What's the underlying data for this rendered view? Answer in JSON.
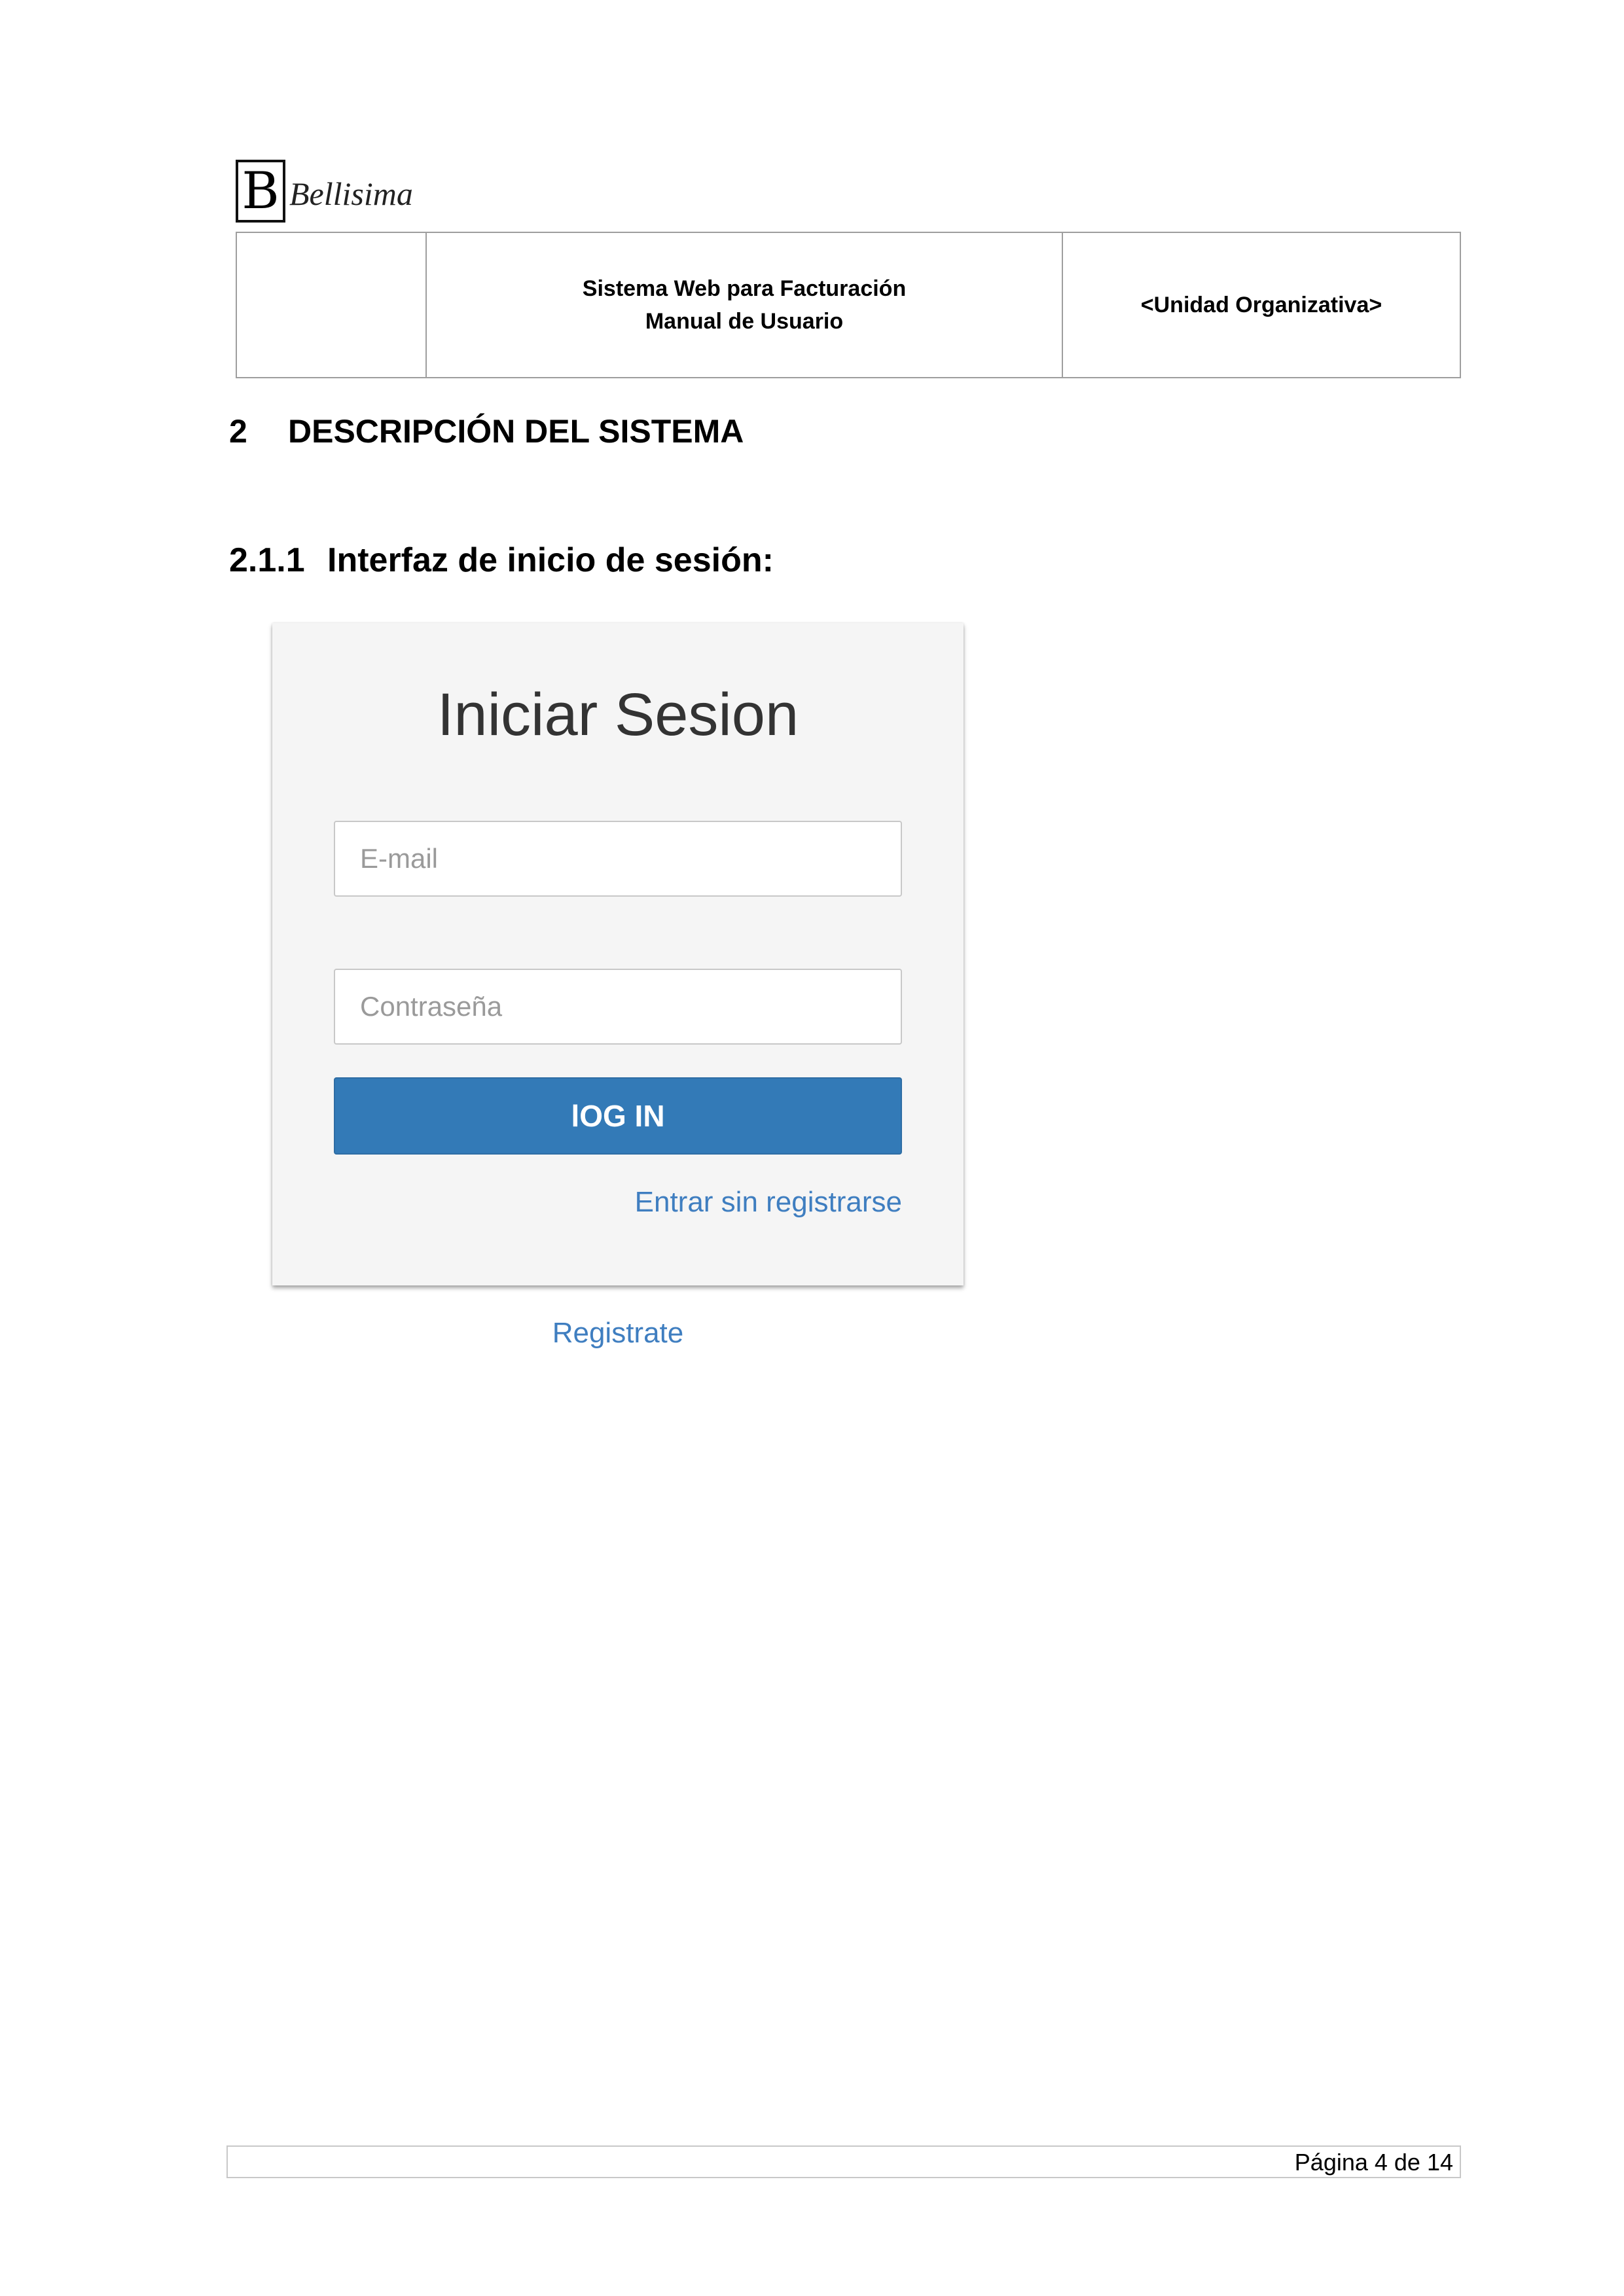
{
  "header": {
    "logo_letter": "B",
    "logo_name": "Bellisima",
    "system_title": "Sistema Web para Facturación",
    "manual_title": "Manual de Usuario",
    "org_unit": "<Unidad Organizativa>"
  },
  "section": {
    "number": "2",
    "title": "DESCRIPCIÓN DEL SISTEMA"
  },
  "subsection": {
    "number": "2.1.1",
    "title": "Interfaz de inicio de sesión:"
  },
  "login": {
    "title": "Iniciar Sesion",
    "email_placeholder": "E-mail",
    "password_placeholder": "Contraseña",
    "login_button": "lOG IN",
    "guest_link": "Entrar sin registrarse",
    "register_link": "Registrate",
    "colors": {
      "button": "#337ab7",
      "link": "#3f7ec0",
      "card_bg": "#f5f5f5"
    }
  },
  "footer": {
    "page_label": "Página 4 de 14"
  }
}
